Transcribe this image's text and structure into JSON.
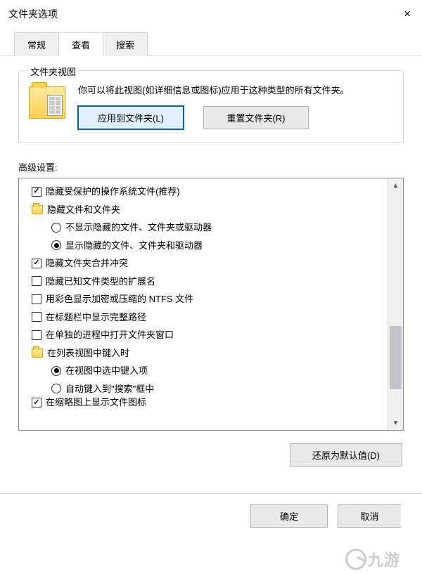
{
  "window": {
    "title": "文件夹选项",
    "close": "×"
  },
  "tabs": [
    {
      "label": "常规",
      "active": false
    },
    {
      "label": "查看",
      "active": true
    },
    {
      "label": "搜索",
      "active": false
    }
  ],
  "folderView": {
    "legend": "文件夹视图",
    "desc": "你可以将此视图(如详细信息或图标)应用于这种类型的所有文件夹。",
    "apply": "应用到文件夹(L)",
    "reset": "重置文件夹(R)"
  },
  "advLabel": "高级设置:",
  "tree": [
    {
      "type": "checkbox",
      "checked": true,
      "level": 1,
      "label": "隐藏受保护的操作系统文件(推荐)"
    },
    {
      "type": "folder",
      "level": 1,
      "label": "隐藏文件和文件夹"
    },
    {
      "type": "radio",
      "checked": false,
      "level": 2,
      "label": "不显示隐藏的文件、文件夹或驱动器"
    },
    {
      "type": "radio",
      "checked": true,
      "level": 2,
      "label": "显示隐藏的文件、文件夹和驱动器"
    },
    {
      "type": "checkbox",
      "checked": true,
      "level": 1,
      "label": "隐藏文件夹合并冲突"
    },
    {
      "type": "checkbox",
      "checked": false,
      "level": 1,
      "label": "隐藏已知文件类型的扩展名"
    },
    {
      "type": "checkbox",
      "checked": false,
      "level": 1,
      "label": "用彩色显示加密或压缩的 NTFS 文件"
    },
    {
      "type": "checkbox",
      "checked": false,
      "level": 1,
      "label": "在标题栏中显示完整路径"
    },
    {
      "type": "checkbox",
      "checked": false,
      "level": 1,
      "label": "在单独的进程中打开文件夹窗口"
    },
    {
      "type": "folder",
      "level": 1,
      "label": "在列表视图中键入时"
    },
    {
      "type": "radio",
      "checked": true,
      "level": 2,
      "label": "在视图中选中键入项"
    },
    {
      "type": "radio",
      "checked": false,
      "level": 2,
      "label": "自动键入到\"搜索\"框中"
    },
    {
      "type": "checkbox",
      "checked": true,
      "level": 1,
      "label": "在缩略图上显示文件图标",
      "cut": true
    }
  ],
  "restore": "还原为默认值(D)",
  "buttons": {
    "ok": "确定",
    "cancel": "取消"
  },
  "watermark": "九游"
}
